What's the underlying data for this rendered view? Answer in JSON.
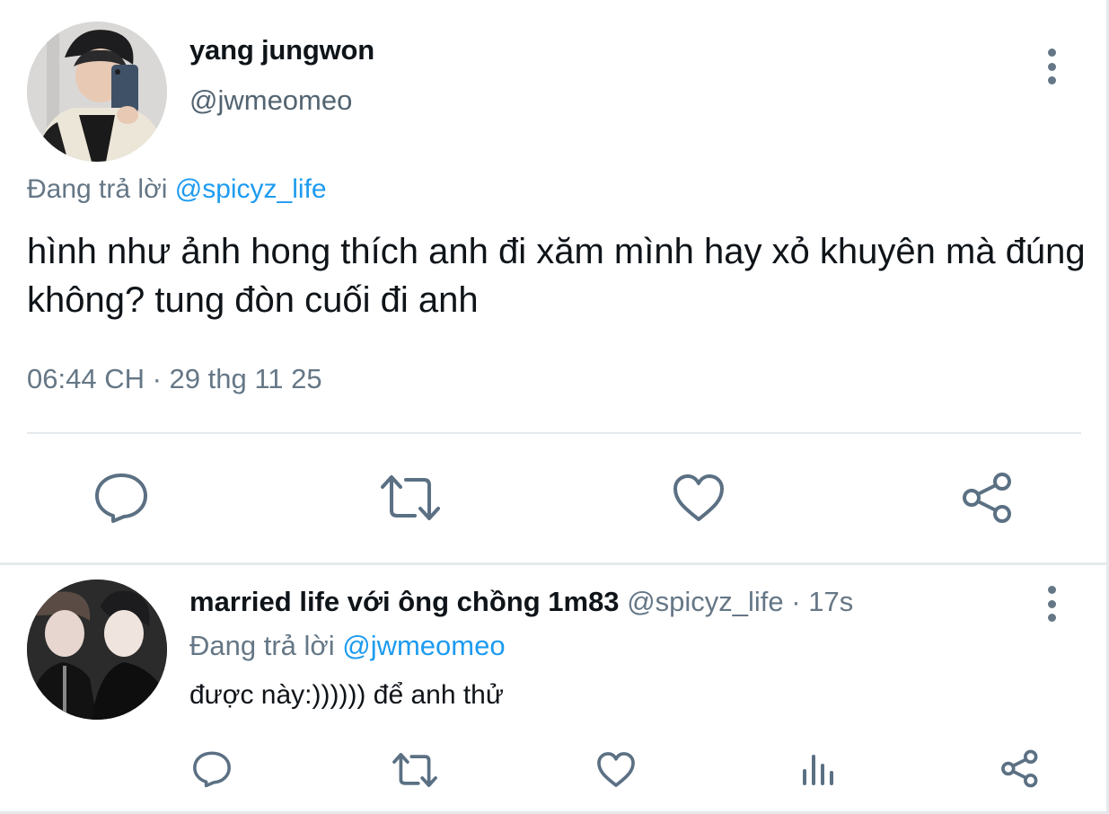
{
  "main_tweet": {
    "author_name": "yang jungwon",
    "author_handle": "@jwmeomeo",
    "replying_prefix": "Đang trả lời ",
    "replying_to": "@spicyz_life",
    "text": "hình như ảnh hong thích anh đi xăm mình hay xỏ khuyên mà đúng không? tung đòn cuối đi anh",
    "timestamp": "06:44 CH · 29 thg 11 25",
    "actions": [
      "reply-icon",
      "retweet-icon",
      "like-icon",
      "share-icon"
    ]
  },
  "reply_tweet": {
    "author_name": "married life với ông chồng 1m83",
    "author_handle": "@spicyz_life",
    "separator": " · ",
    "time_ago": "17s",
    "replying_prefix": "Đang trả lời ",
    "replying_to": "@jwmeomeo",
    "text": "được này:)))))) để anh thử",
    "actions": [
      "reply-icon",
      "retweet-icon",
      "like-icon",
      "analytics-icon",
      "share-icon"
    ]
  },
  "colors": {
    "text_primary": "#0f1419",
    "text_secondary": "#657786",
    "mention": "#1d9bf0",
    "icon": "#5b7083",
    "divider": "#e6e9ec"
  }
}
